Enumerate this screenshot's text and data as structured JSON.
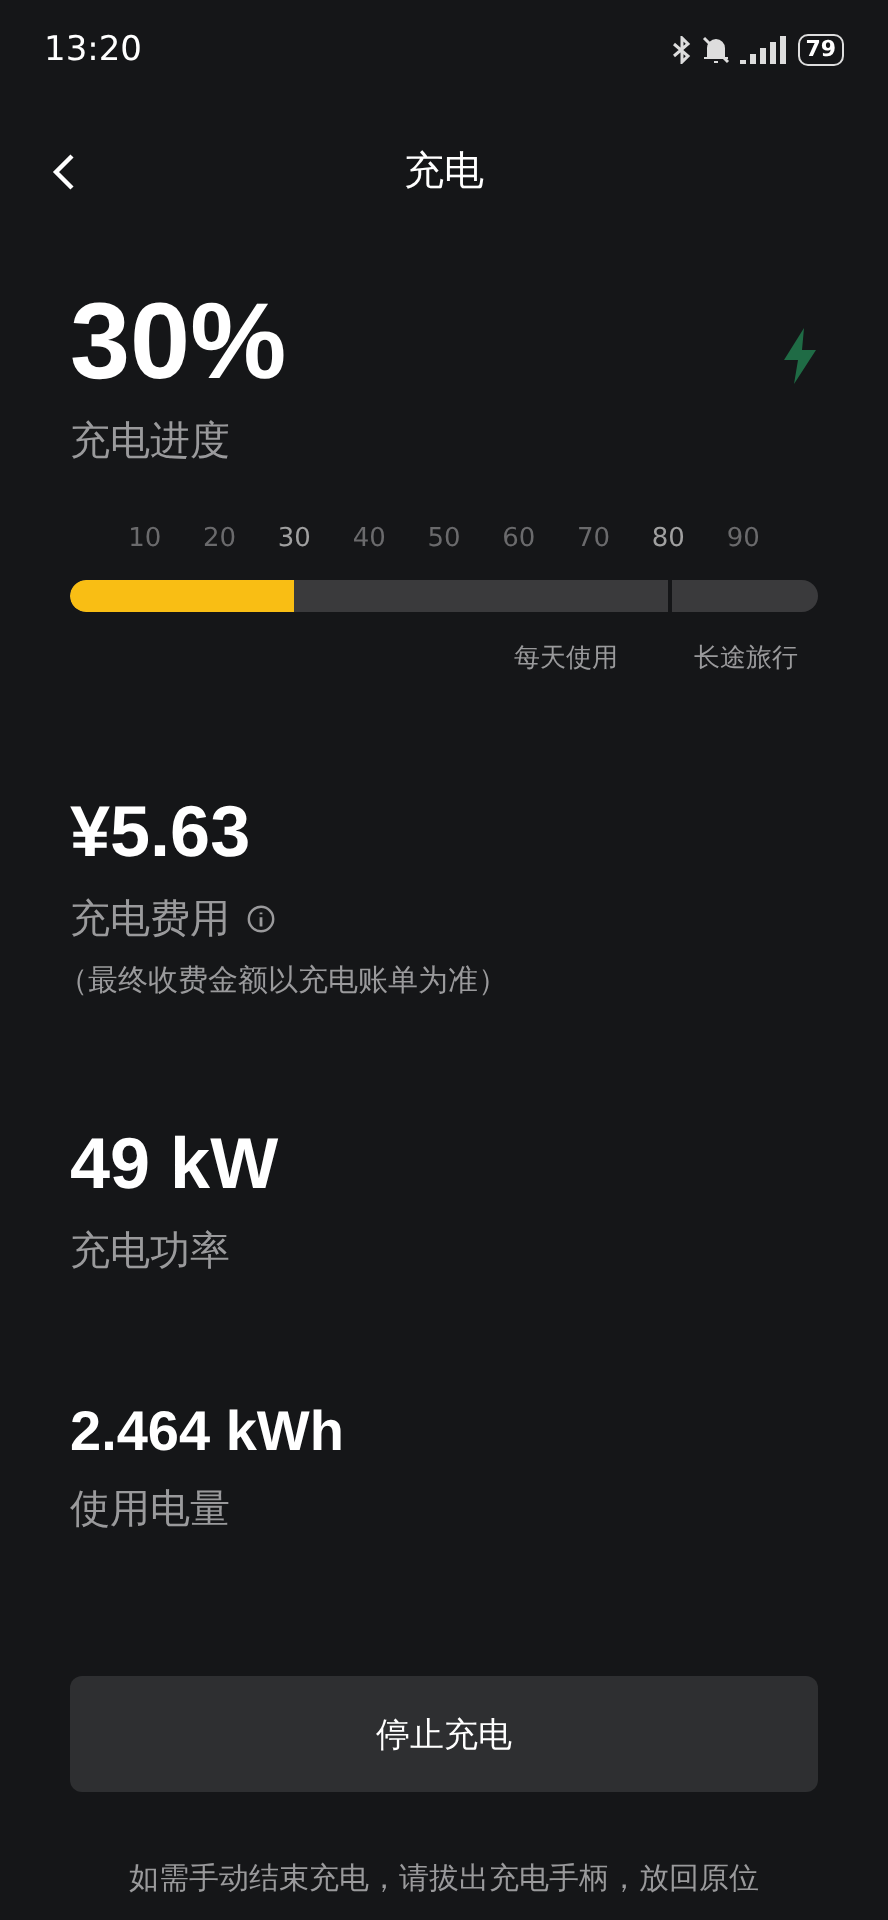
{
  "status_bar": {
    "time": "13:20",
    "battery": "79"
  },
  "header": {
    "title": "充电"
  },
  "progress": {
    "value": "30%",
    "label": "充电进度",
    "level": 0.3,
    "marker": {
      "level": 0.8
    },
    "ticks": [
      {
        "label": "10",
        "highlighted": false
      },
      {
        "label": "20",
        "highlighted": false
      },
      {
        "label": "30",
        "highlighted": true
      },
      {
        "label": "40",
        "highlighted": false
      },
      {
        "label": "50",
        "highlighted": false
      },
      {
        "label": "60",
        "highlighted": false
      },
      {
        "label": "70",
        "highlighted": false
      },
      {
        "label": "80",
        "highlighted": true
      },
      {
        "label": "90",
        "highlighted": false
      }
    ],
    "zones": [
      "每天使用",
      "长途旅行"
    ]
  },
  "stats": [
    {
      "value": "¥5.63",
      "label": "充电费用",
      "info": true,
      "note": "（最终收费金额以充电账单为准）"
    },
    {
      "value": "49 kW",
      "label": "充电功率",
      "info": false
    },
    {
      "value": "2.464 kWh",
      "label": "使用电量",
      "info": false
    }
  ],
  "stop_button": "停止充电",
  "footer": "如需手动结束充电，请拔出充电手柄，放回原位"
}
